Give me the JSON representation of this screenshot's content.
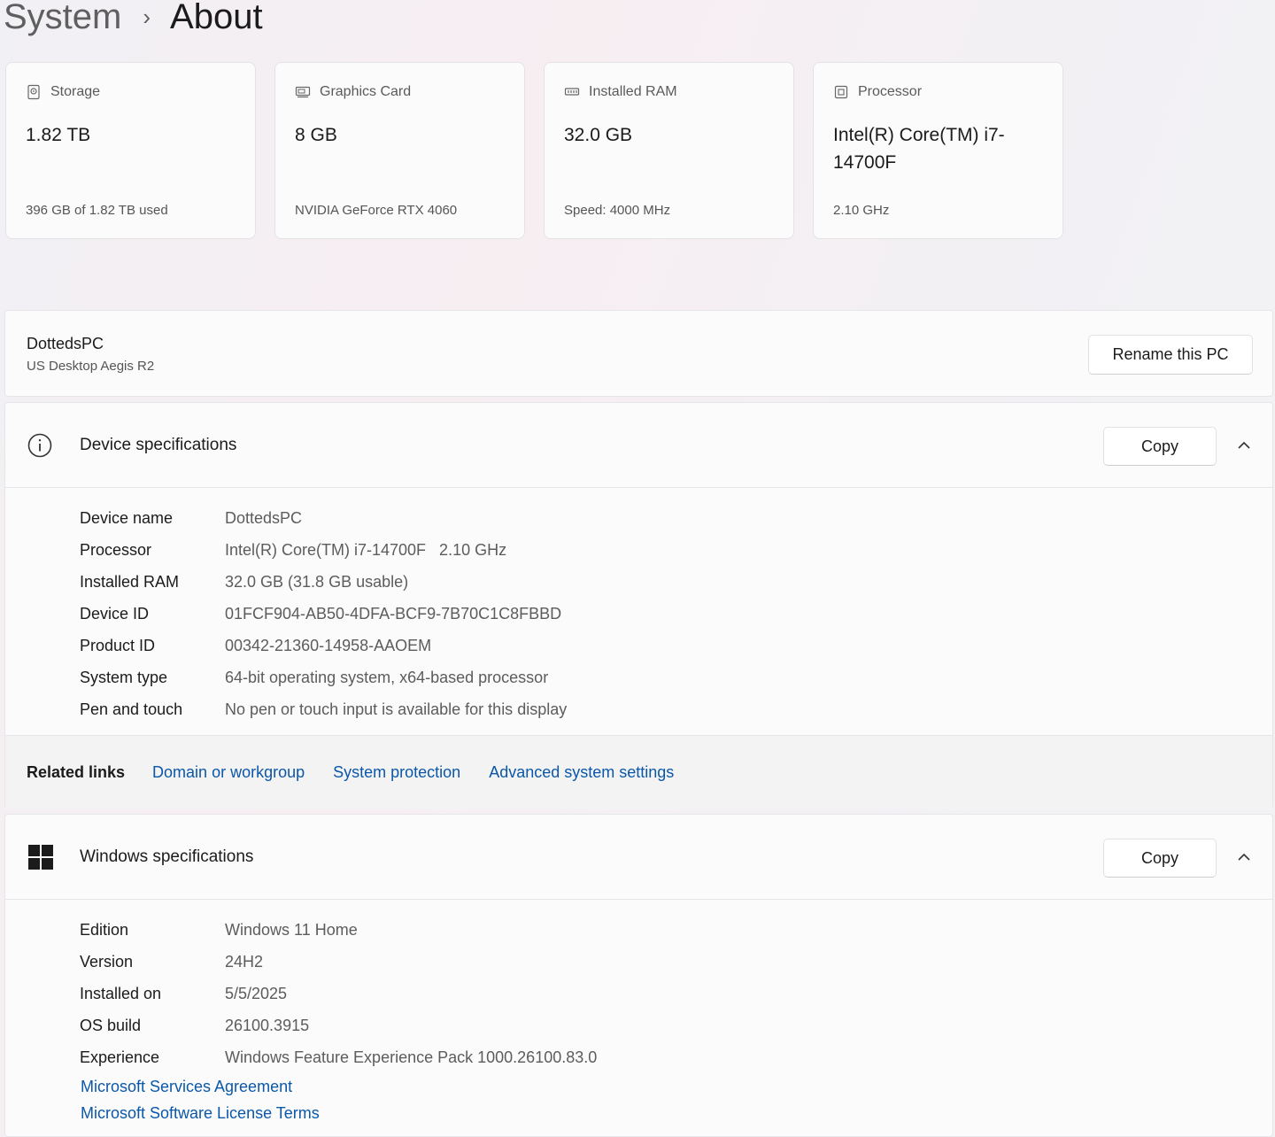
{
  "breadcrumb": {
    "parent": "System",
    "separator": "›",
    "current": "About"
  },
  "cards": [
    {
      "icon": "storage-icon",
      "title": "Storage",
      "value": "1.82 TB",
      "sub": "396 GB of 1.82 TB used"
    },
    {
      "icon": "graphics-card-icon",
      "title": "Graphics Card",
      "value": "8 GB",
      "sub": "NVIDIA GeForce RTX 4060"
    },
    {
      "icon": "ram-icon",
      "title": "Installed RAM",
      "value": "32.0 GB",
      "sub": "Speed: 4000 MHz"
    },
    {
      "icon": "processor-icon",
      "title": "Processor",
      "value": "Intel(R) Core(TM) i7-14700F",
      "sub": "2.10 GHz"
    }
  ],
  "pc": {
    "name": "DottedsPC",
    "model": "US Desktop Aegis R2",
    "rename_label": "Rename this PC"
  },
  "device_specs": {
    "title": "Device specifications",
    "copy_label": "Copy",
    "rows": [
      {
        "label": "Device name",
        "value": "DottedsPC"
      },
      {
        "label": "Processor",
        "value": "Intel(R) Core(TM) i7-14700F   2.10 GHz"
      },
      {
        "label": "Installed RAM",
        "value": "32.0 GB (31.8 GB usable)"
      },
      {
        "label": "Device ID",
        "value": "01FCF904-AB50-4DFA-BCF9-7B70C1C8FBBD"
      },
      {
        "label": "Product ID",
        "value": "00342-21360-14958-AAOEM"
      },
      {
        "label": "System type",
        "value": "64-bit operating system, x64-based processor"
      },
      {
        "label": "Pen and touch",
        "value": "No pen or touch input is available for this display"
      }
    ]
  },
  "related_links": {
    "label": "Related links",
    "links": [
      "Domain or workgroup",
      "System protection",
      "Advanced system settings"
    ]
  },
  "windows_specs": {
    "title": "Windows specifications",
    "copy_label": "Copy",
    "rows": [
      {
        "label": "Edition",
        "value": "Windows 11 Home"
      },
      {
        "label": "Version",
        "value": "24H2"
      },
      {
        "label": "Installed on",
        "value": "5/5/2025"
      },
      {
        "label": "OS build",
        "value": "26100.3915"
      },
      {
        "label": "Experience",
        "value": "Windows Feature Experience Pack 1000.26100.83.0"
      }
    ],
    "links": [
      "Microsoft Services Agreement",
      "Microsoft Software License Terms"
    ]
  },
  "colors": {
    "link": "#0b57a8",
    "background": "#f3f0f4",
    "panel": "#fbfbfc"
  }
}
